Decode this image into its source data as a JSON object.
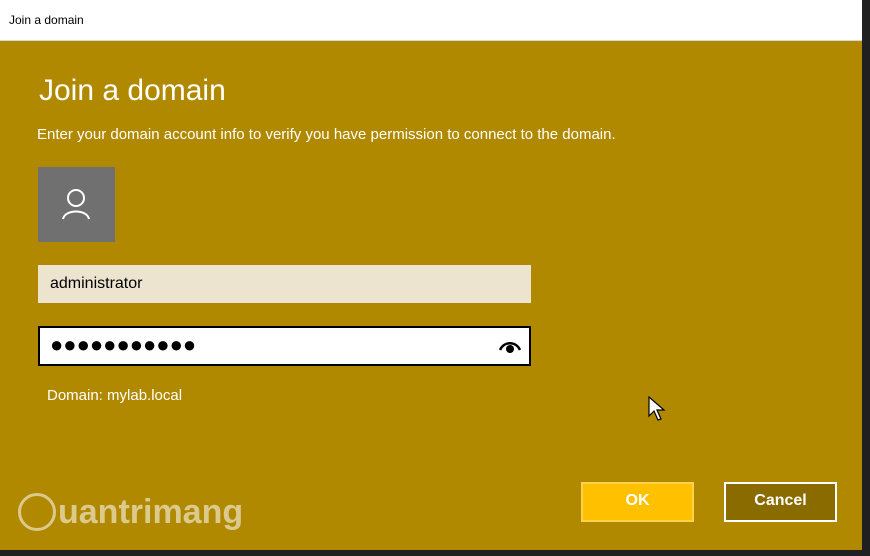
{
  "window": {
    "title": "Join a domain"
  },
  "dialog": {
    "heading": "Join a domain",
    "subtitle": "Enter your domain account info to verify you have permission to connect to the domain.",
    "username_value": "administrator",
    "password_mask": "●●●●●●●●●●●",
    "domain_text": "Domain: mylab.local",
    "ok_label": "OK",
    "cancel_label": "Cancel"
  },
  "watermark": {
    "text": "uantrimang"
  },
  "colors": {
    "dialog_bg": "#b08900",
    "accent_button": "#ffc000",
    "avatar_bg": "#707070"
  },
  "icons": {
    "avatar": "person-icon",
    "reveal": "eye-icon",
    "pointer": "mouse-cursor-icon",
    "watermark_logo": "bulb-icon"
  }
}
